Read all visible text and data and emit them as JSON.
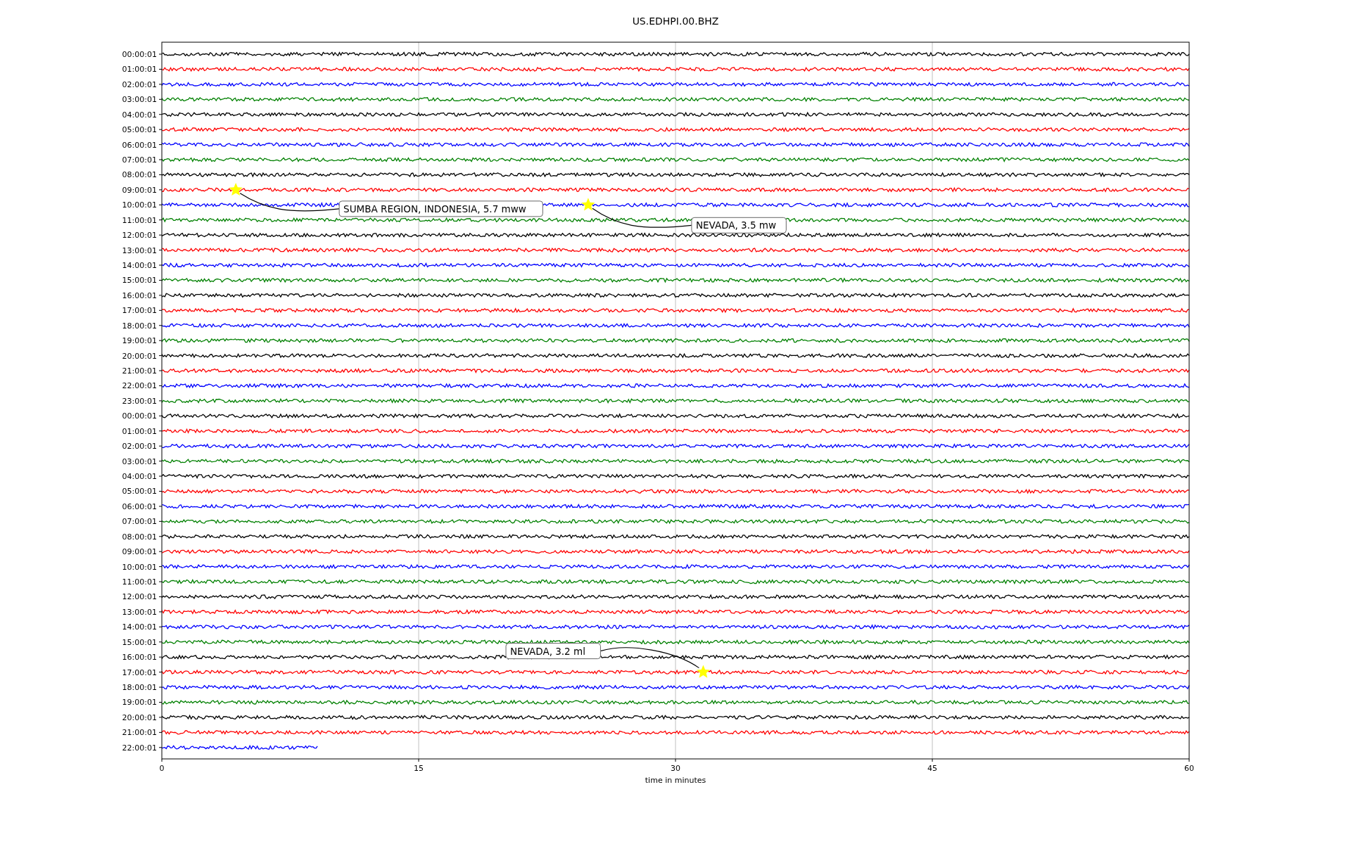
{
  "title": "US.EDHPI.00.BHZ",
  "rows": [
    {
      "label": "00:00:01",
      "color": "#000000",
      "level": 1
    },
    {
      "label": "01:00:01",
      "color": "#ff0000",
      "level": 1
    },
    {
      "label": "02:00:01",
      "color": "#0000ff",
      "level": 1
    },
    {
      "label": "03:00:01",
      "color": "#008000",
      "level": 1
    },
    {
      "label": "04:00:01",
      "color": "#000000",
      "level": 1
    },
    {
      "label": "05:00:01",
      "color": "#ff0000",
      "level": 1
    },
    {
      "label": "06:00:01",
      "color": "#0000ff",
      "level": 1
    },
    {
      "label": "07:00:01",
      "color": "#008000",
      "level": 1
    },
    {
      "label": "08:00:01",
      "color": "#000000",
      "level": 1
    },
    {
      "label": "09:00:01",
      "color": "#ff0000",
      "level": 1,
      "event": {
        "label": "SUMBA REGION, INDONESIA, 5.7 mww",
        "level": 0.072
      }
    },
    {
      "label": "10:00:01",
      "color": "#0000ff",
      "level": 1,
      "event": {
        "label": "NEVADA, 3.5 mw",
        "level": 0.415
      }
    },
    {
      "label": "11:00:01",
      "color": "#008000",
      "level": 1
    },
    {
      "label": "12:00:01",
      "color": "#000000",
      "level": 1
    },
    {
      "label": "13:00:01",
      "color": "#ff0000",
      "level": 1
    },
    {
      "label": "14:00:01",
      "color": "#0000ff",
      "level": 1
    },
    {
      "label": "15:00:01",
      "color": "#008000",
      "level": 1
    },
    {
      "label": "16:00:01",
      "color": "#000000",
      "level": 1
    },
    {
      "label": "17:00:01",
      "color": "#ff0000",
      "level": 1
    },
    {
      "label": "18:00:01",
      "color": "#0000ff",
      "level": 1
    },
    {
      "label": "19:00:01",
      "color": "#008000",
      "level": 1
    },
    {
      "label": "20:00:01",
      "color": "#000000",
      "level": 1
    },
    {
      "label": "21:00:01",
      "color": "#ff0000",
      "level": 1
    },
    {
      "label": "22:00:01",
      "color": "#0000ff",
      "level": 1
    },
    {
      "label": "23:00:01",
      "color": "#008000",
      "level": 1
    },
    {
      "label": "00:00:01",
      "color": "#000000",
      "level": 1
    },
    {
      "label": "01:00:01",
      "color": "#ff0000",
      "level": 1
    },
    {
      "label": "02:00:01",
      "color": "#0000ff",
      "level": 1
    },
    {
      "label": "03:00:01",
      "color": "#008000",
      "level": 1
    },
    {
      "label": "04:00:01",
      "color": "#000000",
      "level": 1
    },
    {
      "label": "05:00:01",
      "color": "#ff0000",
      "level": 1
    },
    {
      "label": "06:00:01",
      "color": "#0000ff",
      "level": 1
    },
    {
      "label": "07:00:01",
      "color": "#008000",
      "level": 1
    },
    {
      "label": "08:00:01",
      "color": "#000000",
      "level": 1
    },
    {
      "label": "09:00:01",
      "color": "#ff0000",
      "level": 1
    },
    {
      "label": "10:00:01",
      "color": "#0000ff",
      "level": 1
    },
    {
      "label": "11:00:01",
      "color": "#008000",
      "level": 1
    },
    {
      "label": "12:00:01",
      "color": "#000000",
      "level": 1
    },
    {
      "label": "13:00:01",
      "color": "#ff0000",
      "level": 1
    },
    {
      "label": "14:00:01",
      "color": "#0000ff",
      "level": 1
    },
    {
      "label": "15:00:01",
      "color": "#008000",
      "level": 1
    },
    {
      "label": "16:00:01",
      "color": "#000000",
      "level": 1
    },
    {
      "label": "17:00:01",
      "color": "#ff0000",
      "level": 1,
      "event": {
        "label": "NEVADA, 3.2 ml",
        "level": 0.527
      }
    },
    {
      "label": "18:00:01",
      "color": "#0000ff",
      "level": 1
    },
    {
      "label": "19:00:01",
      "color": "#008000",
      "level": 1
    },
    {
      "label": "20:00:01",
      "color": "#000000",
      "level": 1
    },
    {
      "label": "21:00:01",
      "color": "#ff0000",
      "level": 1
    },
    {
      "label": "22:00:01",
      "color": "#0000ff",
      "level": 0.152
    }
  ],
  "x_ticks": [
    "0",
    "15",
    "30",
    "45",
    "60"
  ],
  "xlabel": "time in minutes"
}
